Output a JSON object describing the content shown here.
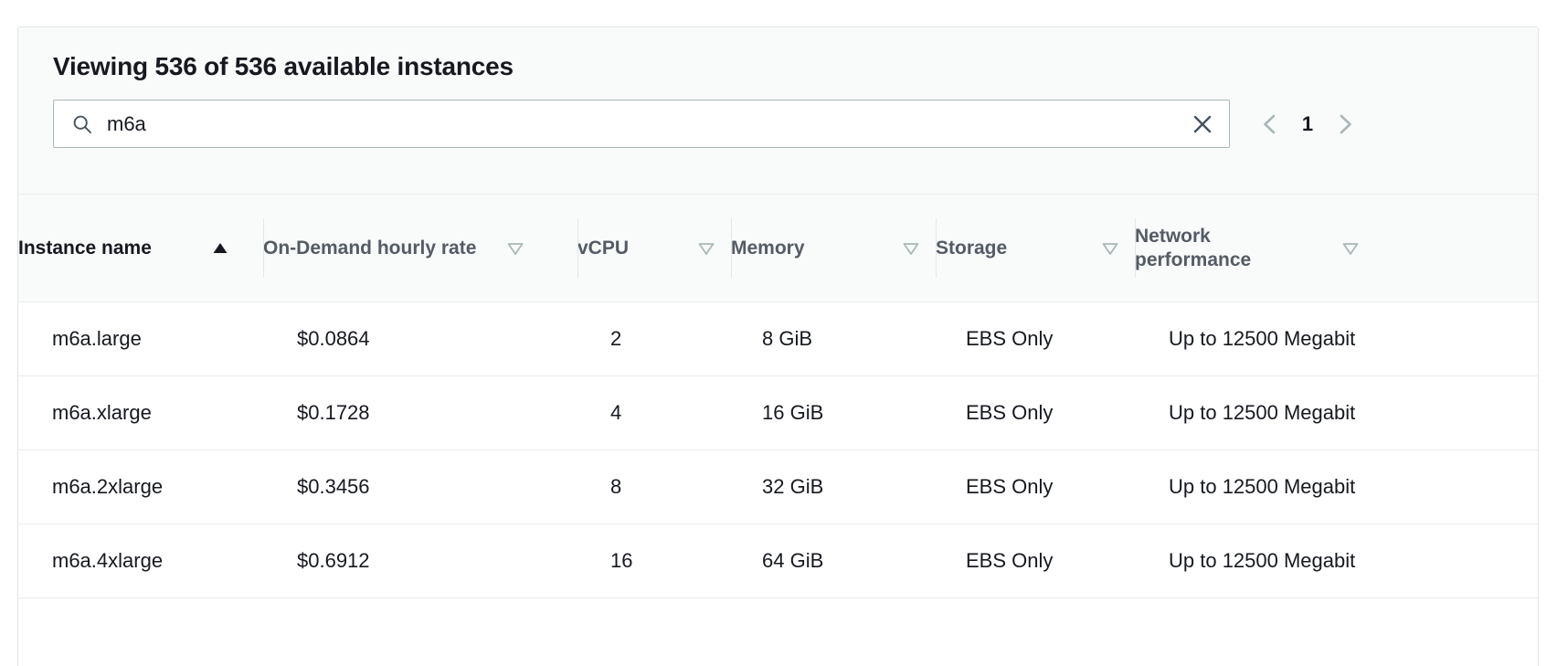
{
  "panel": {
    "title": "Viewing 536 of 536 available instances"
  },
  "search": {
    "value": "m6a",
    "placeholder": "Search",
    "icon": "search-icon",
    "clear_icon": "close-icon"
  },
  "pagination": {
    "prev_icon": "chevron-left-icon",
    "next_icon": "chevron-right-icon",
    "current_page": "1"
  },
  "table": {
    "columns": [
      {
        "label": "Instance name",
        "sort": "ascending",
        "sort_icon": "sort-ascending-icon",
        "active": true
      },
      {
        "label": "On-Demand hourly rate",
        "sort": "none",
        "sort_icon": "sort-descending-icon",
        "active": false
      },
      {
        "label": "vCPU",
        "sort": "none",
        "sort_icon": "sort-descending-icon",
        "active": false
      },
      {
        "label": "Memory",
        "sort": "none",
        "sort_icon": "sort-descending-icon",
        "active": false
      },
      {
        "label": "Storage",
        "sort": "none",
        "sort_icon": "sort-descending-icon",
        "active": false
      },
      {
        "label": "Network performance",
        "sort": "none",
        "sort_icon": "sort-descending-icon",
        "active": false
      }
    ],
    "rows": [
      {
        "instance_name": "m6a.large",
        "rate": "$0.0864",
        "vcpu": "2",
        "memory": "8 GiB",
        "storage": "EBS Only",
        "network": "Up to 12500 Megabit"
      },
      {
        "instance_name": "m6a.xlarge",
        "rate": "$0.1728",
        "vcpu": "4",
        "memory": "16 GiB",
        "storage": "EBS Only",
        "network": "Up to 12500 Megabit"
      },
      {
        "instance_name": "m6a.2xlarge",
        "rate": "$0.3456",
        "vcpu": "8",
        "memory": "32 GiB",
        "storage": "EBS Only",
        "network": "Up to 12500 Megabit"
      },
      {
        "instance_name": "m6a.4xlarge",
        "rate": "$0.6912",
        "vcpu": "16",
        "memory": "64 GiB",
        "storage": "EBS Only",
        "network": "Up to 12500 Megabit"
      },
      {
        "instance_name": "",
        "rate": "",
        "vcpu": "",
        "memory": "",
        "storage": "",
        "network": ""
      }
    ]
  },
  "colors": {
    "text": "#16191f",
    "header_text": "#545b64",
    "border": "#e9edee",
    "panel_header_bg": "#f9fafa",
    "input_border": "#aab7b8",
    "muted_icon": "#aab7b8"
  }
}
